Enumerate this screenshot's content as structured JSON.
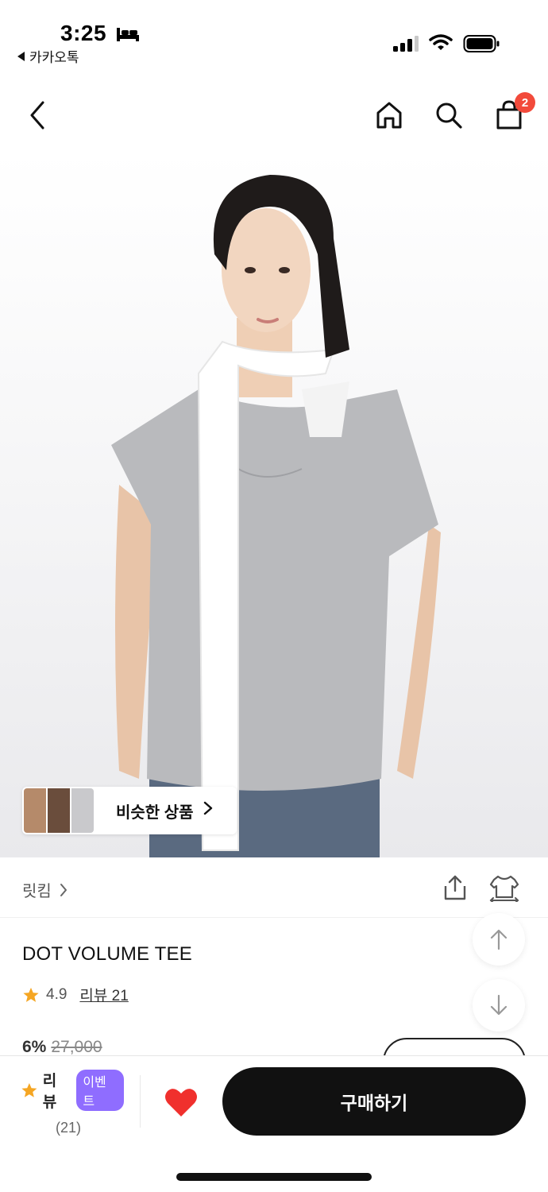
{
  "status_bar": {
    "time": "3:25",
    "back_app": "카카오톡"
  },
  "nav": {
    "cart_count": "2"
  },
  "product_image": {
    "similar_label": "비슷한 상품"
  },
  "brand": {
    "name": "릿킴"
  },
  "product": {
    "title": "DOT VOLUME TEE",
    "rating": "4.9",
    "review_label": "리뷰 21",
    "discount": "6%",
    "original_price": "27,000"
  },
  "bottom_bar": {
    "review_label": "리뷰",
    "event_badge": "이벤트",
    "review_count": "(21)",
    "buy_label": "구매하기"
  },
  "colors": {
    "accent_star": "#f5a623",
    "badge_red": "#f24a3b",
    "event_purple": "#8f6dff",
    "like_red": "#f0302d",
    "buy_button": "#111111"
  }
}
